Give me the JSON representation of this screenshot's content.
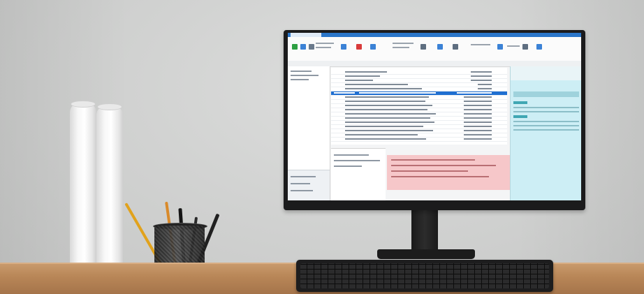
{
  "scene": {
    "colors": {
      "wall": "#d1d2d1",
      "desk": "#b98758",
      "monitor_bezel": "#1b1b1c",
      "ribbon_accent": "#2b76c9",
      "selection": "#1f6fd1",
      "error_panel": "#f6c7c9",
      "side_panel": "#cdeef5"
    },
    "objects": [
      "paper-rolls",
      "pen-cup",
      "monitor",
      "keyboard",
      "desk"
    ]
  }
}
